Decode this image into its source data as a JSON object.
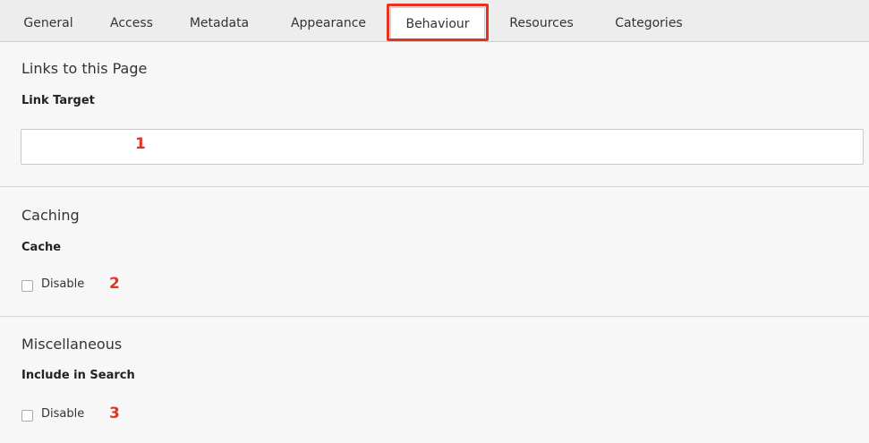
{
  "tabs": [
    {
      "label": "General"
    },
    {
      "label": "Access"
    },
    {
      "label": "Metadata"
    },
    {
      "label": "Appearance"
    },
    {
      "label": "Behaviour"
    },
    {
      "label": "Resources"
    },
    {
      "label": "Categories"
    }
  ],
  "active_tab": "Behaviour",
  "sections": {
    "links": {
      "title": "Links to this Page",
      "field_label": "Link Target",
      "input_value": "",
      "marker": "1"
    },
    "caching": {
      "title": "Caching",
      "field_label": "Cache",
      "checkbox_label": "Disable",
      "checked": false,
      "marker": "2"
    },
    "misc": {
      "title": "Miscellaneous",
      "field_label": "Include in Search",
      "checkbox_label": "Disable",
      "checked": false,
      "marker": "3"
    }
  },
  "colors": {
    "annotation": "#e8321f",
    "background": "#f7f7f7",
    "tabbar": "#ededed"
  }
}
